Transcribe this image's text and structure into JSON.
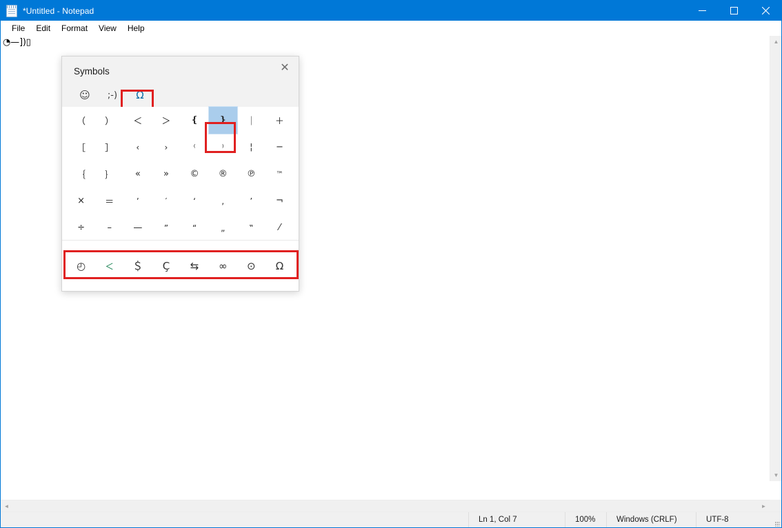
{
  "window": {
    "title": "*Untitled - Notepad",
    "icon": "notepad-icon",
    "titlebar_color": "#0078d7",
    "controls": {
      "minimize": "minimize-icon",
      "maximize": "maximize-icon",
      "close": "close-icon"
    }
  },
  "menu": {
    "items": [
      {
        "label": "File"
      },
      {
        "label": "Edit"
      },
      {
        "label": "Format"
      },
      {
        "label": "View"
      },
      {
        "label": "Help"
      }
    ]
  },
  "editor": {
    "content": "\u0001—])▯",
    "content_display": "◔—])▯"
  },
  "status_bar": {
    "cursor": "Ln 1, Col 7",
    "zoom": "100%",
    "line_ending": "Windows (CRLF)",
    "encoding": "UTF-8",
    "grip": "resize-grip"
  },
  "scrollbars": {
    "vertical": {
      "up": "▲",
      "down": "▼"
    },
    "horizontal": {
      "left": "◄",
      "right": "►"
    }
  },
  "symbols_panel": {
    "title": "Symbols",
    "close_label": "✕",
    "tabs": [
      {
        "name": "emoji",
        "glyph": "☺",
        "active": false
      },
      {
        "name": "kaomoji",
        "glyph": ";-)",
        "active": false
      },
      {
        "name": "symbols",
        "glyph": "Ω",
        "active": true
      }
    ],
    "active_tab": "symbols",
    "active_tab_color": "#0f6fa8",
    "grid": {
      "columns": 8,
      "rows": 5,
      "cells": [
        {
          "glyph": "（",
          "size": "md",
          "selected": false
        },
        {
          "glyph": "）",
          "size": "md",
          "selected": false
        },
        {
          "glyph": "＜",
          "size": "md",
          "selected": false
        },
        {
          "glyph": "＞",
          "size": "md",
          "selected": false
        },
        {
          "glyph": "❴",
          "size": "md",
          "selected": false
        },
        {
          "glyph": "❵",
          "size": "md",
          "selected": true
        },
        {
          "glyph": "｜",
          "size": "md",
          "selected": false
        },
        {
          "glyph": "＋",
          "size": "md",
          "selected": false
        },
        {
          "glyph": "［",
          "size": "md",
          "selected": false
        },
        {
          "glyph": "］",
          "size": "md",
          "selected": false
        },
        {
          "glyph": "‹",
          "size": "sm",
          "selected": false
        },
        {
          "glyph": "›",
          "size": "sm",
          "selected": false
        },
        {
          "glyph": "⁽",
          "size": "sm",
          "selected": false
        },
        {
          "glyph": "⁾",
          "size": "sm",
          "selected": false
        },
        {
          "glyph": "¦",
          "size": "md",
          "selected": false
        },
        {
          "glyph": "−",
          "size": "md",
          "selected": false
        },
        {
          "glyph": "｛",
          "size": "md",
          "selected": false
        },
        {
          "glyph": "｝",
          "size": "md",
          "selected": false
        },
        {
          "glyph": "«",
          "size": "md",
          "selected": false
        },
        {
          "glyph": "»",
          "size": "md",
          "selected": false
        },
        {
          "glyph": "©",
          "size": "md",
          "selected": false
        },
        {
          "glyph": "®",
          "size": "md",
          "selected": false
        },
        {
          "glyph": "℗",
          "size": "md",
          "selected": false
        },
        {
          "glyph": "™",
          "size": "xs",
          "selected": false
        },
        {
          "glyph": "×",
          "size": "md",
          "selected": false
        },
        {
          "glyph": "＝",
          "size": "md",
          "selected": false
        },
        {
          "glyph": "ʼ",
          "size": "sm",
          "selected": false
        },
        {
          "glyph": "′",
          "size": "sm",
          "selected": false
        },
        {
          "glyph": "‘",
          "size": "sm",
          "selected": false
        },
        {
          "glyph": "‚",
          "size": "sm",
          "selected": false
        },
        {
          "glyph": "’",
          "size": "sm",
          "selected": false
        },
        {
          "glyph": "¬",
          "size": "md",
          "selected": false
        },
        {
          "glyph": "÷",
          "size": "md",
          "selected": false
        },
        {
          "glyph": "–",
          "size": "md",
          "selected": false
        },
        {
          "glyph": "—",
          "size": "md",
          "selected": false
        },
        {
          "glyph": "”",
          "size": "sm",
          "selected": false
        },
        {
          "glyph": "“",
          "size": "sm",
          "selected": false
        },
        {
          "glyph": "„",
          "size": "sm",
          "selected": false
        },
        {
          "glyph": "‟",
          "size": "sm",
          "selected": false
        },
        {
          "glyph": "⁄",
          "size": "md",
          "selected": false
        }
      ]
    },
    "categories": [
      {
        "name": "recently-used",
        "glyph": "◴",
        "label": "recent-clock-icon",
        "active": false
      },
      {
        "name": "punctuation",
        "glyph": "＜",
        "label": "punctuation-icon",
        "active": true
      },
      {
        "name": "currency",
        "glyph": "＄",
        "label": "currency-icon",
        "active": false
      },
      {
        "name": "latin",
        "glyph": "Ç",
        "label": "latin-icon",
        "active": false
      },
      {
        "name": "geometric-arrows",
        "glyph": "⇆",
        "label": "arrows-icon",
        "active": false
      },
      {
        "name": "math",
        "glyph": "∞",
        "label": "math-icon",
        "active": false
      },
      {
        "name": "geometric",
        "glyph": "⊙",
        "label": "geometric-icon",
        "active": false
      },
      {
        "name": "greek",
        "glyph": "Ω",
        "label": "greek-icon",
        "active": false
      }
    ],
    "active_category": "punctuation",
    "active_category_color": "#107c4b"
  },
  "annotations": {
    "color": "#e02020",
    "boxes": [
      {
        "name": "symbols-tab-highlight",
        "target": "symbols-tab"
      },
      {
        "name": "selected-symbol-highlight",
        "target": "grid-cell-ornate-close-brace"
      },
      {
        "name": "category-bar-highlight",
        "target": "category-bar"
      }
    ]
  }
}
